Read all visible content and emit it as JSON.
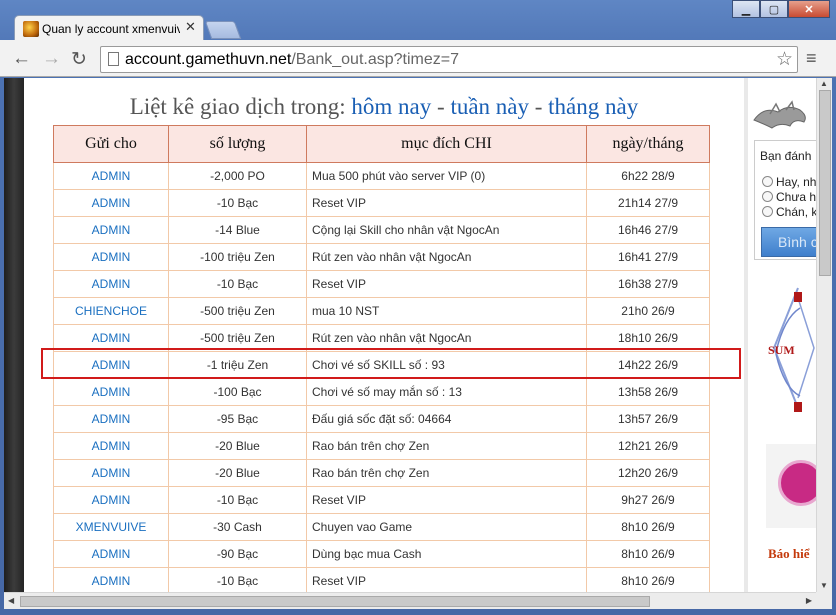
{
  "browser": {
    "tab_title": "Quan ly account xmenvuive | Gam",
    "url_host": "account.gamethuvn.net",
    "url_path": "/Bank_out.asp?timez=7",
    "icons": [
      "back-icon",
      "forward-icon",
      "reload-icon",
      "star-icon",
      "menu-icon",
      "close-icon"
    ]
  },
  "heading": {
    "prefix": "Liệt kê giao dịch trong:",
    "today": "hôm nay",
    "sep1": "-",
    "week": "tuần này",
    "sep2": "-",
    "month": "tháng này"
  },
  "table": {
    "headers": [
      "Gửi cho",
      "số lượng",
      "mục đích CHI",
      "ngày/tháng"
    ],
    "rows": [
      [
        "ADMIN",
        "-2,000  PO",
        "Mua 500 phút vào server VIP (0)",
        "6h22 28/9"
      ],
      [
        "ADMIN",
        "-10  Bạc",
        "Reset VIP",
        "21h14 27/9"
      ],
      [
        "ADMIN",
        "-14  Blue",
        "Cộng lại Skill cho nhân vật NgocAn",
        "16h46 27/9"
      ],
      [
        "ADMIN",
        "-100  triệu Zen",
        "Rút zen vào nhân vật NgocAn",
        "16h41 27/9"
      ],
      [
        "ADMIN",
        "-10  Bạc",
        "Reset VIP",
        "16h38 27/9"
      ],
      [
        "CHIENCHOE",
        "-500  triệu Zen",
        "mua 10 NST",
        "21h0 26/9"
      ],
      [
        "ADMIN",
        "-500  triệu Zen",
        "Rút zen vào nhân vật NgocAn",
        "18h10 26/9"
      ],
      [
        "ADMIN",
        "-1  triệu Zen",
        "Chơi vé số SKILL số : 93",
        "14h22 26/9"
      ],
      [
        "ADMIN",
        "-100  Bạc",
        "Chơi vé số may mắn số : 13",
        "13h58 26/9"
      ],
      [
        "ADMIN",
        "-95  Bạc",
        "Đấu giá sốc đặt số: 04664",
        "13h57 26/9"
      ],
      [
        "ADMIN",
        "-20  Blue",
        "Rao bán trên chợ Zen",
        "12h21 26/9"
      ],
      [
        "ADMIN",
        "-20  Blue",
        "Rao bán trên chợ Zen",
        "12h20 26/9"
      ],
      [
        "ADMIN",
        "-10  Bạc",
        "Reset VIP",
        "9h27 26/9"
      ],
      [
        "XMENVUIVE",
        "-30  Cash",
        "Chuyen vao Game",
        "8h10 26/9"
      ],
      [
        "ADMIN",
        "-90  Bạc",
        "Dùng bạc mua Cash",
        "8h10 26/9"
      ],
      [
        "ADMIN",
        "-10  Bạc",
        "Reset VIP",
        "8h10 26/9"
      ]
    ]
  },
  "sidebar": {
    "poll_question": "Bạn đánh",
    "options": [
      "Hay, nh",
      "Chưa h",
      "Chán, k"
    ],
    "vote_label": "Bình c",
    "diagram_labels": [
      "SUM"
    ],
    "banner": "Báo hiể"
  },
  "colors": {
    "link": "#1a5fb4",
    "header_bg": "#fbe6e2",
    "highlight": "#d11a1a"
  }
}
